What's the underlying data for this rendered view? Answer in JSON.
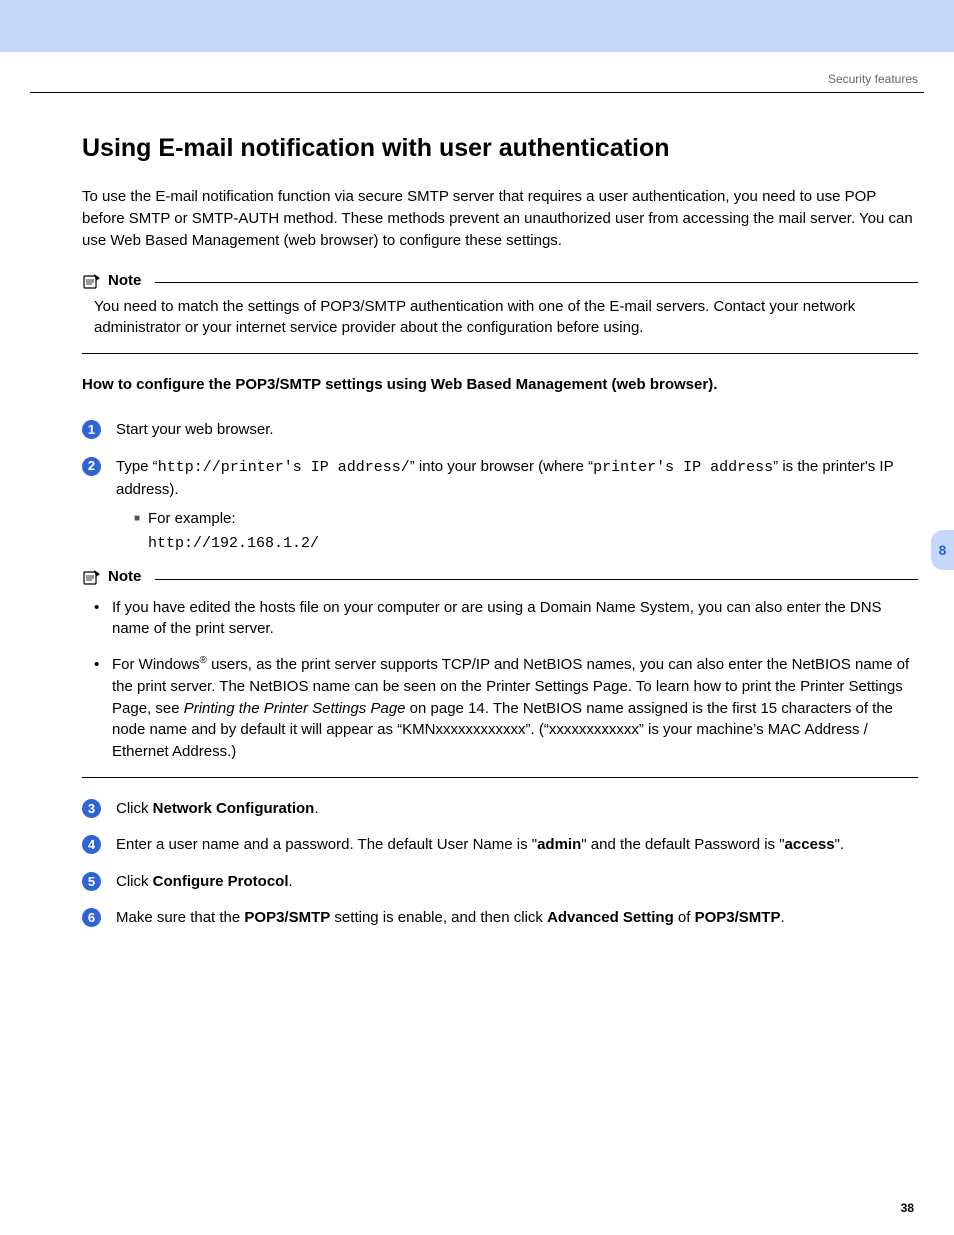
{
  "header": {
    "section": "Security features"
  },
  "title": "Using E-mail notification with user authentication",
  "intro": "To use the E-mail notification function via secure SMTP server that requires a user authentication, you need to use POP before SMTP or SMTP-AUTH method. These methods prevent an unauthorized user from accessing the mail server. You can use Web Based Management (web browser) to configure these settings.",
  "note1": {
    "label": "Note",
    "body": "You need to match the settings of POP3/SMTP authentication with one of the E-mail servers. Contact your network administrator or your internet service provider about the configuration before using."
  },
  "howto": "How to configure the POP3/SMTP settings using Web Based Management (web browser).",
  "steps": {
    "s1": "Start your web browser.",
    "s2_prefix": "Type “",
    "s2_code1": "http://printer's IP address/",
    "s2_mid": "” into your browser (where “",
    "s2_code2": "printer's IP address",
    "s2_suffix": "” is the printer's IP address).",
    "s2_example_label": "For example:",
    "s2_example_code": "http://192.168.1.2/",
    "s3_prefix": "Click ",
    "s3_bold": "Network Configuration",
    "s3_suffix": ".",
    "s4_a": "Enter a user name and a password. The default User Name is \"",
    "s4_b": "admin",
    "s4_c": "\" and the default Password is \"",
    "s4_d": "access",
    "s4_e": "\".",
    "s5_prefix": "Click ",
    "s5_bold": "Configure Protocol",
    "s5_suffix": ".",
    "s6_a": "Make sure that the ",
    "s6_b": "POP3/SMTP",
    "s6_c": " setting is enable, and then click ",
    "s6_d": "Advanced Setting",
    "s6_e": " of ",
    "s6_f": "POP3/SMTP",
    "s6_g": "."
  },
  "note2": {
    "label": "Note",
    "b1": "If you have edited the hosts file on your computer or are using a Domain Name System, you can also enter the DNS name of the print server.",
    "b2_a": "For Windows",
    "b2_b": " users, as the print server supports TCP/IP and NetBIOS names, you can also enter the NetBIOS name of the print server. The NetBIOS name can be seen on the Printer Settings Page. To learn how to print the Printer Settings Page, see ",
    "b2_ref": "Printing the Printer Settings Page",
    "b2_c": " on page 14. The NetBIOS name assigned is the first 15 characters of the node name and by default it will appear as “KMNxxxxxxxxxxxx”. (“xxxxxxxxxxxx” is your machine’s MAC Address / Ethernet Address.)"
  },
  "sidetab": "8",
  "page_number": "38"
}
